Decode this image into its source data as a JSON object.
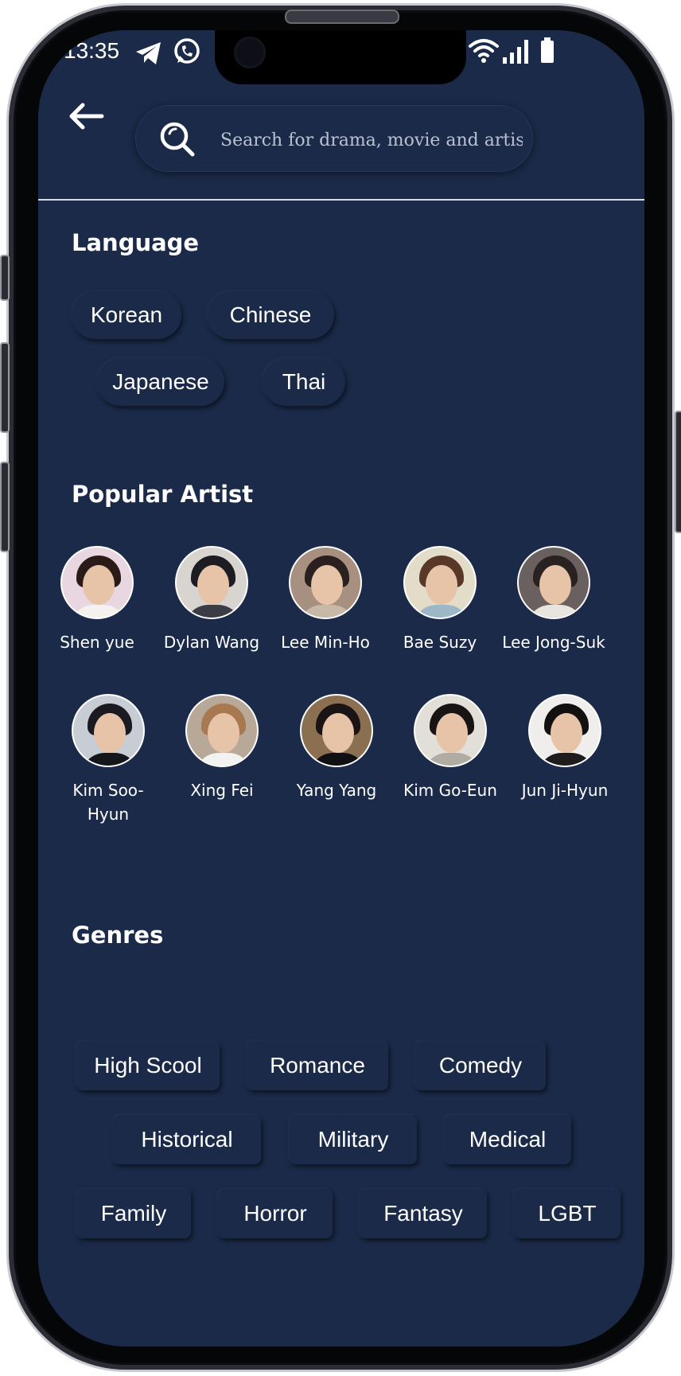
{
  "status_bar": {
    "time": "13:35"
  },
  "search": {
    "placeholder": "Search for drama, movie and artist"
  },
  "language": {
    "title": "Language",
    "options": [
      "Korean",
      "Chinese",
      "Japanese",
      "Thai"
    ]
  },
  "popular_artist": {
    "title": "Popular Artist",
    "artists": [
      {
        "name": "Shen yue"
      },
      {
        "name": "Dylan Wang"
      },
      {
        "name": "Lee Min-Ho"
      },
      {
        "name": "Bae Suzy"
      },
      {
        "name": "Lee Jong-Suk"
      },
      {
        "name": "Kim Soo-Hyun"
      },
      {
        "name": "Xing Fei"
      },
      {
        "name": "Yang Yang"
      },
      {
        "name": "Kim Go-Eun"
      },
      {
        "name": "Jun Ji-Hyun"
      }
    ]
  },
  "genres": {
    "title": "Genres",
    "items": [
      "High Scool",
      "Romance",
      "Comedy",
      "Historical",
      "Military",
      "Medical",
      "Family",
      "Horror",
      "Fantasy",
      "LGBT"
    ]
  },
  "colors": {
    "background": "#1a2a48",
    "text": "#ffffff",
    "divider": "#d7dbe4"
  }
}
